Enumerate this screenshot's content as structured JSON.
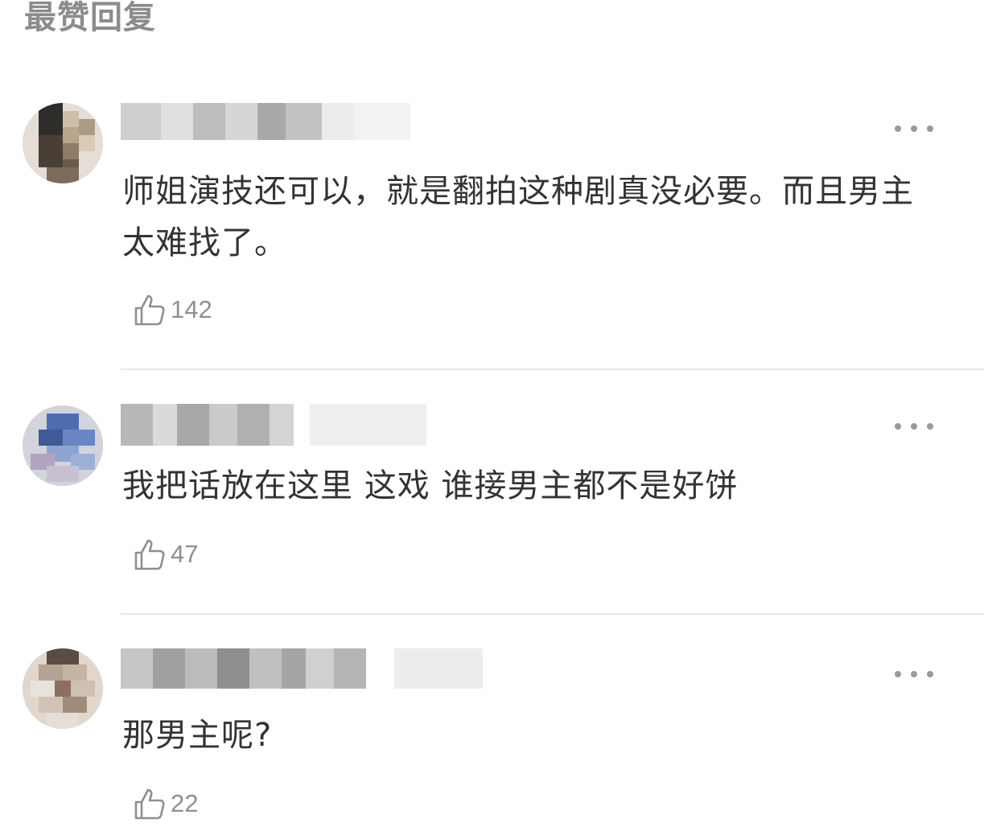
{
  "section": {
    "title": "最赞回复"
  },
  "comments": [
    {
      "content": "师姐演技还可以，就是翻拍这种剧真没必要。而且男主太难找了。",
      "likes": "142"
    },
    {
      "content": "我把话放在这里 这戏 谁接男主都不是好饼",
      "likes": "47"
    },
    {
      "content": "那男主呢?",
      "likes": "22"
    }
  ],
  "icons": {
    "like": "thumbs-up-icon",
    "more": "more-dots-icon"
  },
  "colors": {
    "text": "#333333",
    "muted": "#8f8f8f",
    "divider": "#e8e8e8"
  }
}
